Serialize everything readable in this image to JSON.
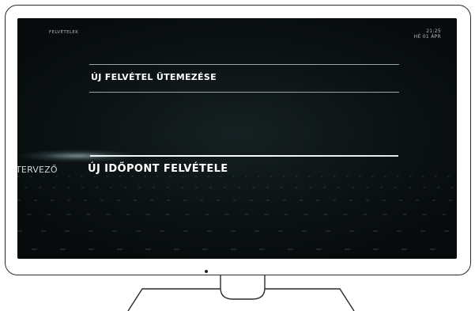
{
  "screen": {
    "section_title": "FELVÉTELEK",
    "clock": {
      "time": "21:25",
      "date": "HÉ 01 ÁPR"
    },
    "menu": {
      "title": "ÚJ FELVÉTEL ÜTEMEZÉSE"
    },
    "carousel": {
      "category_label": "TERVEZŐ",
      "selected_item": "ÚJ IDŐPONT FELVÉTELE"
    }
  },
  "colors": {
    "screen_background": "#0b1112",
    "text_primary": "#ffffff",
    "text_secondary": "#aeb5b7",
    "divider": "#9aa4a6"
  },
  "icons": {
    "power_led": "dot-icon"
  }
}
